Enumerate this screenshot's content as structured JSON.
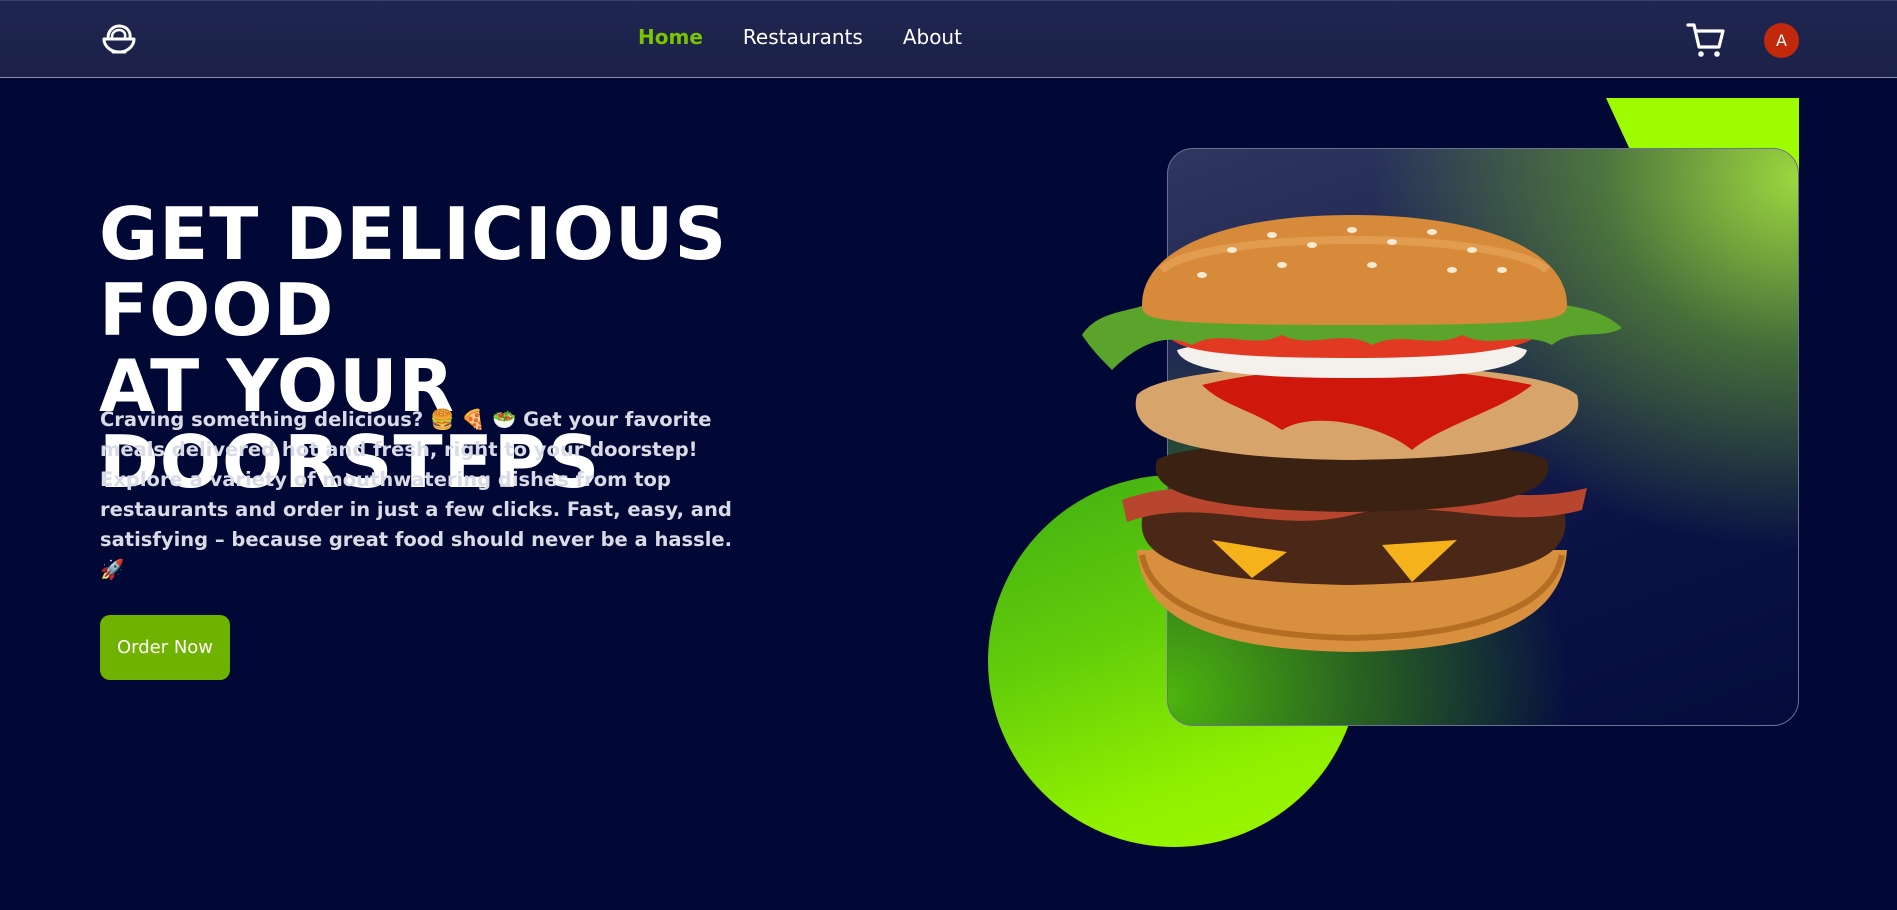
{
  "nav": {
    "logo_icon": "food-bowl-icon",
    "links": [
      {
        "label": "Home",
        "active": true
      },
      {
        "label": "Restaurants",
        "active": false
      },
      {
        "label": "About",
        "active": false
      }
    ],
    "cart_icon": "shopping-cart-icon",
    "avatar_initial": "A",
    "avatar_color": "#c1280c"
  },
  "hero": {
    "title_line1": "GET DELICIOUS FOOD",
    "title_line2": "AT YOUR DOORSTEPS",
    "description": "Craving something delicious? 🍔 🍕 🥗 Get your favorite meals delivered hot and fresh, right to your doorstep! Explore a variety of mouthwatering dishes from top restaurants and order in just a few clicks. Fast, easy, and satisfying – because great food should never be a hassle. 🚀",
    "cta_label": "Order Now",
    "image": "burger-image"
  },
  "colors": {
    "background": "#010836",
    "accent_green": "#6fb300",
    "highlight_green": "#9dfc00"
  }
}
